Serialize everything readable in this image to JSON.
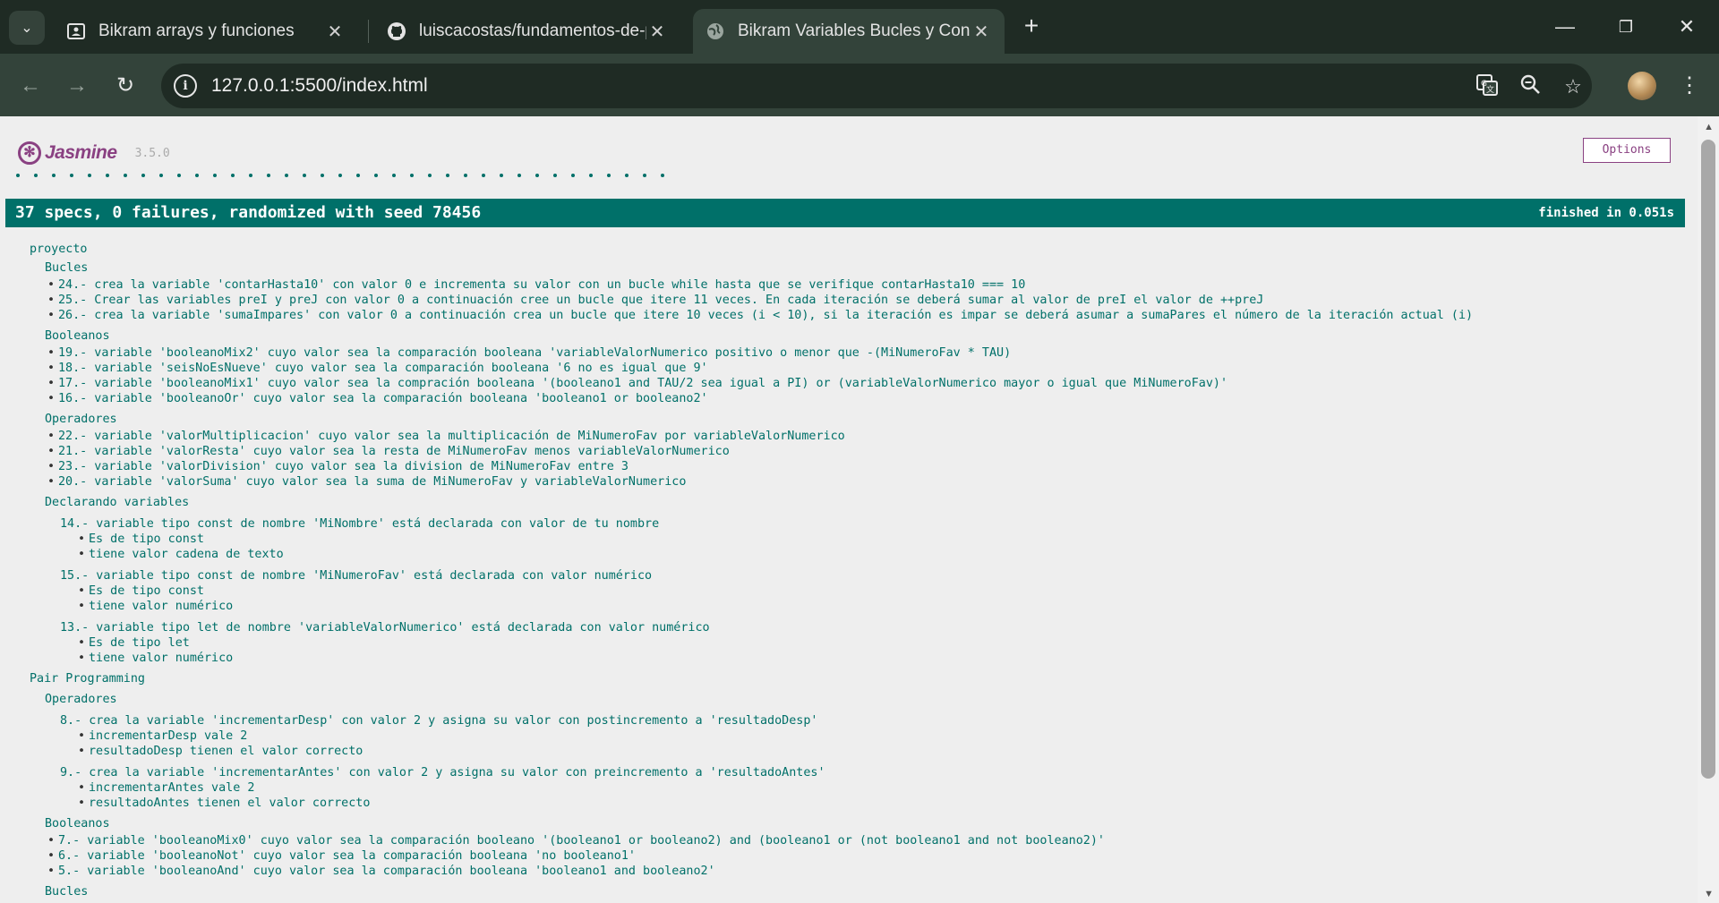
{
  "browser": {
    "tabs": [
      {
        "title": "Bikram arrays y funciones",
        "icon": "contact-icon"
      },
      {
        "title": "luiscacostas/fundamentos-de-p",
        "icon": "github-icon"
      },
      {
        "title": "Bikram Variables Bucles y Condi",
        "icon": "globe-icon",
        "active": true
      }
    ],
    "url": "127.0.0.1:5500/index.html"
  },
  "jasmine": {
    "name": "Jasmine",
    "version": "3.5.0",
    "options_label": "Options",
    "dot_count": 37,
    "summary": "37 specs, 0 failures, randomized with seed 78456",
    "duration": "finished in 0.051s"
  },
  "suites": {
    "proyecto": {
      "label": "proyecto",
      "bucles": {
        "label": "Bucles",
        "specs": [
          "24.- crea la variable 'contarHasta10' con valor 0 e incrementa su valor con un bucle while hasta que se verifique contarHasta10 === 10",
          "25.- Crear las variables preI y preJ con valor 0 a continuación cree un bucle que itere 11 veces. En cada iteración se deberá sumar al valor de preI el valor de ++preJ",
          "26.- crea la variable 'sumaImpares' con valor 0 a continuación crea un bucle que itere 10 veces (i < 10), si la iteración es impar se deberá asumar a sumaPares el número de la iteración actual (i)"
        ]
      },
      "booleanos": {
        "label": "Booleanos",
        "specs": [
          "19.- variable 'booleanoMix2' cuyo valor sea la comparación booleana 'variableValorNumerico positivo o menor que -(MiNumeroFav * TAU)",
          "18.- variable 'seisNoEsNueve' cuyo valor sea la comparación booleana '6 no es igual que 9'",
          "17.- variable 'booleanoMix1' cuyo valor sea la compración booleana '(booleano1 and TAU/2 sea igual a PI) or (variableValorNumerico mayor o igual que MiNumeroFav)'",
          "16.- variable 'booleanoOr' cuyo valor sea la comparación booleana 'booleano1 or booleano2'"
        ]
      },
      "operadores": {
        "label": "Operadores",
        "specs": [
          "22.- variable 'valorMultiplicacion' cuyo valor sea la multiplicación de MiNumeroFav por variableValorNumerico",
          "21.- variable 'valorResta' cuyo valor sea la resta de MiNumeroFav menos variableValorNumerico",
          "23.- variable 'valorDivision' cuyo valor sea la division de MiNumeroFav entre 3",
          "20.- variable 'valorSuma' cuyo valor sea la suma de MiNumeroFav y variableValorNumerico"
        ]
      },
      "declarando": {
        "label": "Declarando variables",
        "groups": [
          {
            "title": "14.- variable tipo const de nombre 'MiNombre' está declarada con valor de tu nombre",
            "specs": [
              "Es de tipo const",
              "tiene valor cadena de texto"
            ]
          },
          {
            "title": "15.- variable tipo const de nombre 'MiNumeroFav' está declarada con valor numérico",
            "specs": [
              "Es de tipo const",
              "tiene valor numérico"
            ]
          },
          {
            "title": "13.- variable tipo let de nombre 'variableValorNumerico' está declarada con valor numérico",
            "specs": [
              "Es de tipo let",
              "tiene valor numérico"
            ]
          }
        ]
      }
    },
    "pair": {
      "label": "Pair Programming",
      "operadores": {
        "label": "Operadores",
        "groups": [
          {
            "title": "8.- crea la variable 'incrementarDesp' con valor 2 y asigna su valor con postincremento a 'resultadoDesp'",
            "specs": [
              "incrementarDesp vale 2",
              "resultadoDesp tienen el valor correcto"
            ]
          },
          {
            "title": "9.- crea la variable 'incrementarAntes' con valor 2 y asigna su valor con preincremento a 'resultadoAntes'",
            "specs": [
              "incrementarAntes vale 2",
              "resultadoAntes tienen el valor correcto"
            ]
          }
        ]
      },
      "booleanos": {
        "label": "Booleanos",
        "specs": [
          "7.- variable 'booleanoMix0' cuyo valor sea la comparación booleano '(booleano1 or booleano2) and (booleano1 or (not booleano1 and not booleano2)'",
          "6.- variable 'booleanoNot' cuyo valor sea la comparación booleana 'no booleano1'",
          "5.- variable 'booleanoAnd' cuyo valor sea la comparación booleana 'booleano1 and booleano2'"
        ]
      },
      "next_label": "Bucles"
    }
  },
  "colors": {
    "accent": "#007069",
    "brand": "#8a4182"
  }
}
